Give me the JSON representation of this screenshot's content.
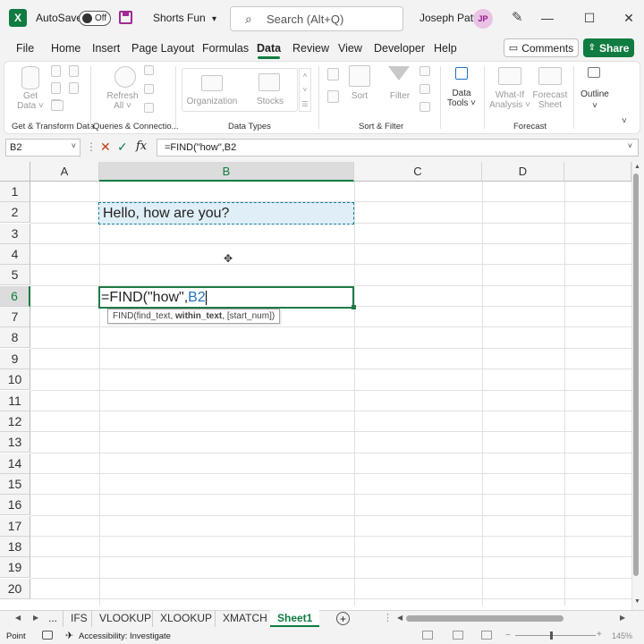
{
  "titlebar": {
    "app_icon": "excel-logo-icon",
    "app_letter": "X",
    "autosave_label": "AutoSave",
    "autosave_state": "Off",
    "doc_name": "Shorts Fun",
    "doc_dropdown": "▾",
    "search_placeholder": "Search (Alt+Q)",
    "user_name": "Joseph Patti",
    "user_initials": "JP",
    "min": "—",
    "max": "☐",
    "close": "✕"
  },
  "menu": {
    "tabs": [
      "File",
      "Home",
      "Insert",
      "Page Layout",
      "Formulas",
      "Data",
      "Review",
      "View",
      "Developer",
      "Help"
    ],
    "active": "Data",
    "comments": "Comments",
    "share": "Share"
  },
  "ribbon": {
    "get_data": "Get\nData ˅",
    "refresh_all": "Refresh\nAll ˅",
    "organization": "Organization",
    "stocks": "Stocks",
    "sort": "Sort",
    "filter": "Filter",
    "data_tools": "Data\nTools ˅",
    "what_if": "What-If\nAnalysis ˅",
    "forecast_sheet": "Forecast\nSheet",
    "outline": "Outline",
    "groups": [
      "Get & Transform Data",
      "Queries & Connectio...",
      "Data Types",
      "Sort & Filter",
      "Forecast"
    ]
  },
  "formula_bar": {
    "name_box": "B2",
    "cancel": "✕",
    "enter": "✓",
    "fx": "fx",
    "formula": "=FIND(\"how\",B2"
  },
  "grid": {
    "columns": [
      "A",
      "B",
      "C",
      "D"
    ],
    "selected_column": "B",
    "rows": [
      "1",
      "2",
      "3",
      "4",
      "5",
      "6",
      "7",
      "8",
      "9",
      "10",
      "11",
      "12",
      "13",
      "14",
      "15",
      "16",
      "17",
      "18",
      "19",
      "20"
    ],
    "selected_row": "6",
    "b2_value": "Hello, how are you?",
    "b6_prefix": "=FIND(\"how\",",
    "b6_ref": "B2",
    "tooltip_pre": "FIND(find_text, ",
    "tooltip_bold": "within_text",
    "tooltip_post": ", [start_num])"
  },
  "sheets": {
    "tabs": [
      "IFS",
      "VLOOKUP",
      "XLOOKUP",
      "XMATCH",
      "Sheet1"
    ],
    "active": "Sheet1",
    "more": "...",
    "add": "+"
  },
  "status": {
    "mode": "Point",
    "accessibility": "Accessibility: Investigate",
    "zoom": "145%"
  },
  "colors": {
    "brand": "#107c41",
    "ref_blue": "#1f6fbf",
    "marching_ants": "#117e93"
  }
}
